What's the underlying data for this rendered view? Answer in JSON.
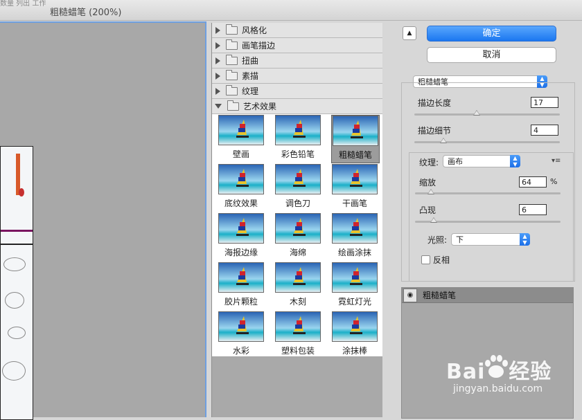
{
  "window": {
    "title": "粗糙蜡笔 (200%)",
    "ghost_text": "数量 列出 工作"
  },
  "categories": [
    {
      "label": "风格化",
      "open": false
    },
    {
      "label": "画笔描边",
      "open": false
    },
    {
      "label": "扭曲",
      "open": false
    },
    {
      "label": "素描",
      "open": false
    },
    {
      "label": "纹理",
      "open": false
    },
    {
      "label": "艺术效果",
      "open": true
    }
  ],
  "filters": [
    "壁画",
    "彩色铅笔",
    "粗糙蜡笔",
    "底纹效果",
    "调色刀",
    "干画笔",
    "海报边缘",
    "海绵",
    "绘画涂抹",
    "胶片颗粒",
    "木刻",
    "霓虹灯光",
    "水彩",
    "塑料包装",
    "涂抹棒"
  ],
  "selected_filter": "粗糙蜡笔",
  "buttons": {
    "ok": "确定",
    "cancel": "取消",
    "collapse_icon": "▲"
  },
  "filter_select": {
    "value": "粗糙蜡笔"
  },
  "params": {
    "stroke_length_label": "描边长度",
    "stroke_length_value": "17",
    "stroke_detail_label": "描边细节",
    "stroke_detail_value": "4",
    "texture_label": "纹理:",
    "texture_value": "画布",
    "scale_label": "缩放",
    "scale_value": "64",
    "scale_unit": "%",
    "relief_label": "凸现",
    "relief_value": "6",
    "light_label": "光照:",
    "light_value": "下",
    "invert_label": "反相"
  },
  "slider_levels": {
    "stroke_length": 0.43,
    "stroke_detail": 0.2,
    "scale": 0.11,
    "relief": 0.13
  },
  "layers": [
    {
      "name": "粗糙蜡笔",
      "visible": true
    }
  ],
  "watermark": {
    "brand": "Bai",
    "brand2": "经验",
    "url": "jingyan.baidu.com"
  }
}
